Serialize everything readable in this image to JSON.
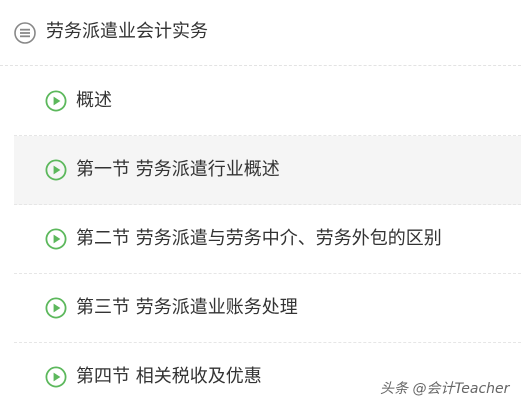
{
  "course": {
    "title": "劳务派遣业会计实务",
    "icon": "menu-list-icon"
  },
  "chapters": [
    {
      "label": "概述",
      "icon": "play-circle-icon",
      "highlighted": false
    },
    {
      "label": "第一节 劳务派遣行业概述",
      "icon": "play-circle-icon",
      "highlighted": true
    },
    {
      "label": "第二节 劳务派遣与劳务中介、劳务外包的区别",
      "icon": "play-circle-icon",
      "highlighted": false
    },
    {
      "label": "第三节 劳务派遣业账务处理",
      "icon": "play-circle-icon",
      "highlighted": false
    },
    {
      "label": "第四节 相关税收及优惠",
      "icon": "play-circle-icon",
      "highlighted": false
    }
  ],
  "watermark": "头条 @会计Teacher",
  "colors": {
    "accent_green": "#5cb85c",
    "menu_icon_gray": "#888888",
    "highlight_row": "#f5f5f5"
  }
}
